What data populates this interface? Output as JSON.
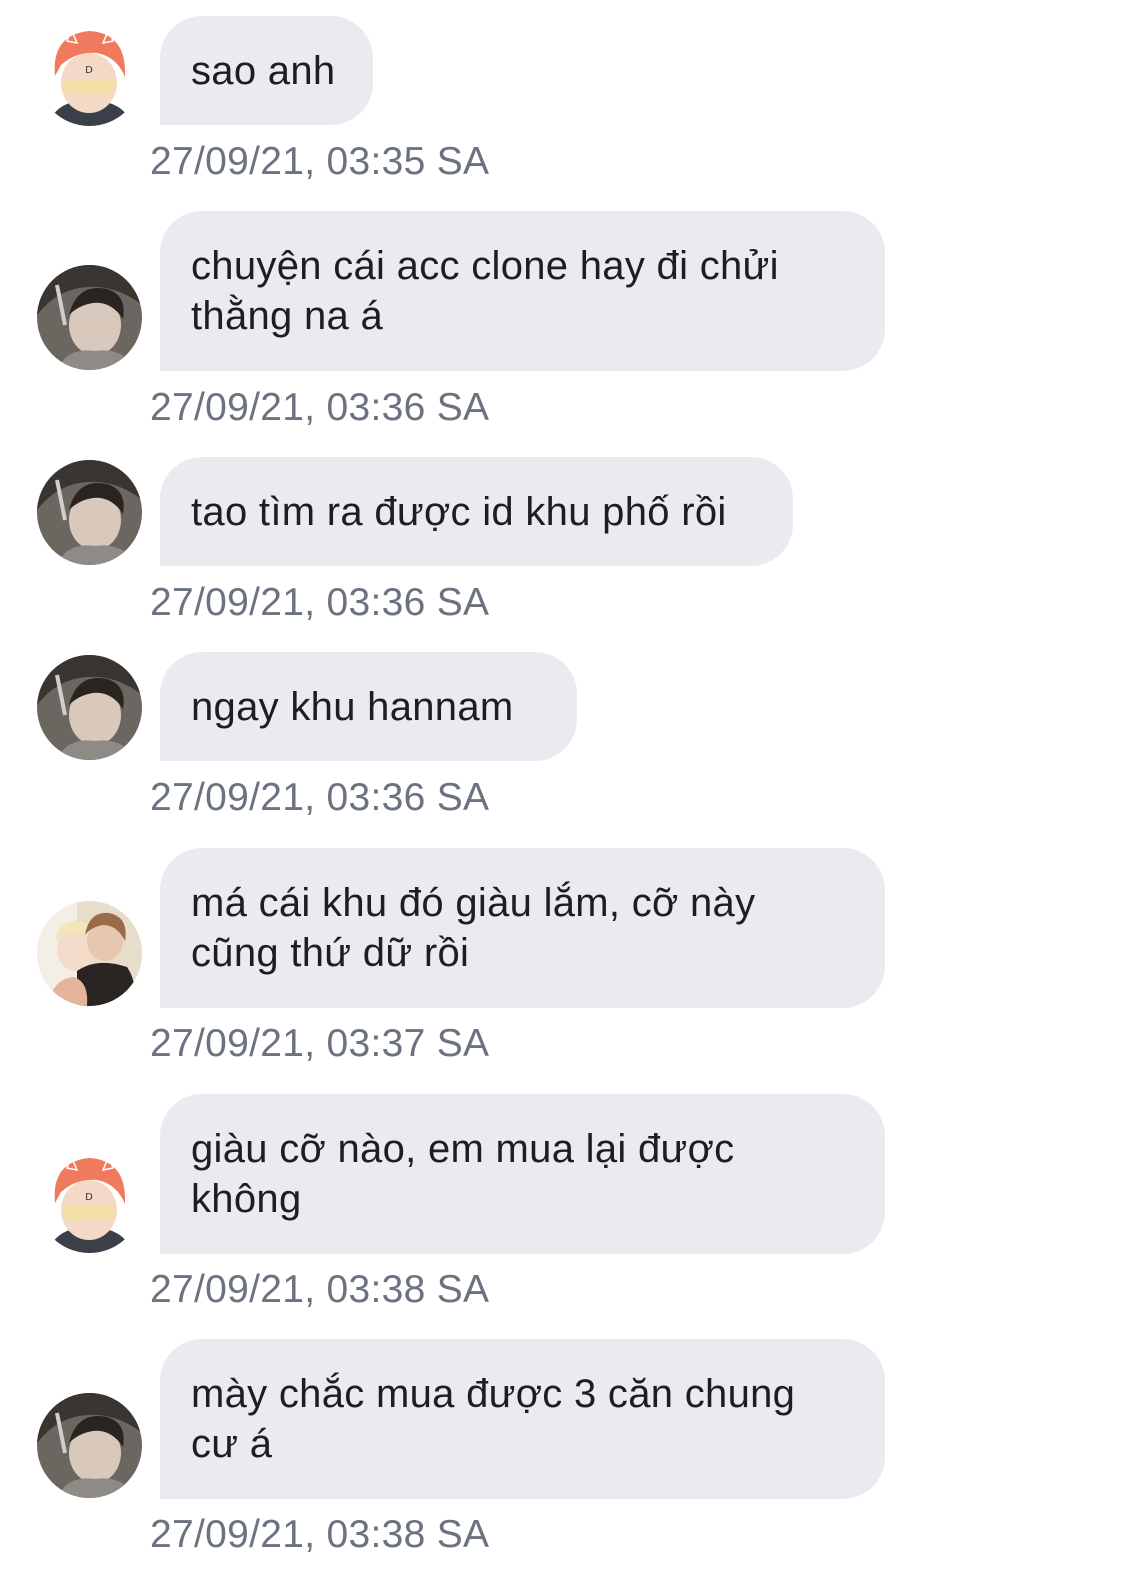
{
  "messages": [
    {
      "sender": "orange-hair",
      "text": "sao anh",
      "time": "27/09/21, 03:35 SA"
    },
    {
      "sender": "dark-hair",
      "text": "chuyện cái acc clone hay đi chửi thằng na á",
      "time": "27/09/21, 03:36 SA"
    },
    {
      "sender": "dark-hair",
      "text": "tao tìm ra được id khu phố rồi",
      "time": "27/09/21, 03:36 SA"
    },
    {
      "sender": "dark-hair",
      "text": "ngay khu hannam",
      "time": "27/09/21, 03:36 SA"
    },
    {
      "sender": "couple",
      "text": "má cái khu đó giàu lắm, cỡ này cũng thứ dữ rồi",
      "time": "27/09/21, 03:37 SA"
    },
    {
      "sender": "orange-hair",
      "text": "giàu cỡ nào, em mua lại được không",
      "time": "27/09/21, 03:38 SA"
    },
    {
      "sender": "dark-hair",
      "text": "mày chắc mua được 3 căn chung cư á",
      "time": "27/09/21, 03:38 SA"
    }
  ],
  "colors": {
    "bubble": "#e9ebf0",
    "text": "#1c1e21",
    "timestamp": "#6b7280"
  }
}
